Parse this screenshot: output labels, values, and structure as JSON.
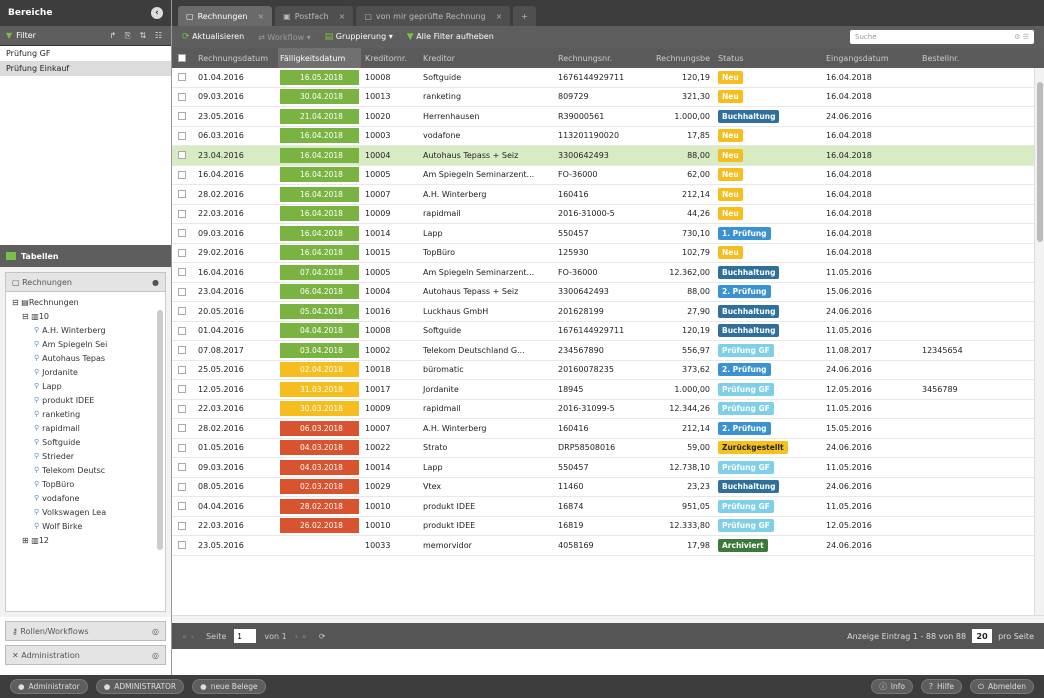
{
  "left": {
    "title": "Bereiche",
    "filter_label": "Filter",
    "filters": [
      "Prüfung GF",
      "Prüfung Einkauf"
    ],
    "tables_label": "Tabellen",
    "tree_header": "Rechnungen",
    "tree": {
      "root": "Rechnungen",
      "group": "10",
      "items": [
        "A.H. Winterberg",
        "Am Spiegeln Sei",
        "Autohaus Tepas",
        "Jordanite",
        "Lapp",
        "produkt IDEE",
        "ranketing",
        "rapidmail",
        "Softguide",
        "Strieder",
        "Telekom Deutsc",
        "TopBüro",
        "vodafone",
        "Volkswagen Lea",
        "Wolf Birke"
      ],
      "group2": "12"
    },
    "rollen": "Rollen/Workflows",
    "admin": "Administration"
  },
  "tabs": [
    {
      "label": "Rechnungen",
      "active": true
    },
    {
      "label": "Postfach",
      "active": false
    },
    {
      "label": "von mir geprüfte Rechnung",
      "active": false
    }
  ],
  "toolbar": {
    "refresh": "Aktualisieren",
    "workflow": "Workflow",
    "grouping": "Gruppierung",
    "clear_filters": "Alle Filter aufheben",
    "search_placeholder": "Suche"
  },
  "columns": [
    "Rechnungsdatum",
    "Fälligkeitsdatum",
    "Kreditornr.",
    "Kreditor",
    "Rechnungsnr.",
    "Rechnungsbe",
    "Status",
    "Eingangsdatum",
    "Bestellnr."
  ],
  "rows": [
    {
      "rd": "01.04.2016",
      "fd": "16.05.2018",
      "due": "green",
      "kn": "10008",
      "kr": "Softguide",
      "rn": "1676144929711",
      "rb": "120,19",
      "st": "Neu",
      "sc": "b-neu",
      "ed": "16.04.2018",
      "bn": ""
    },
    {
      "rd": "09.03.2016",
      "fd": "30.04.2018",
      "due": "green",
      "kn": "10013",
      "kr": "ranketing",
      "rn": "809729",
      "rb": "321,30",
      "st": "Neu",
      "sc": "b-neu",
      "ed": "16.04.2018",
      "bn": ""
    },
    {
      "rd": "23.05.2016",
      "fd": "21.04.2018",
      "due": "green",
      "kn": "10020",
      "kr": "Herrenhausen",
      "rn": "R39000561",
      "rb": "1.000,00",
      "st": "Buchhaltung",
      "sc": "b-buch",
      "ed": "24.06.2016",
      "bn": ""
    },
    {
      "rd": "06.03.2016",
      "fd": "16.04.2018",
      "due": "green",
      "kn": "10003",
      "kr": "vodafone",
      "rn": "113201190020",
      "rb": "17,85",
      "st": "Neu",
      "sc": "b-neu",
      "ed": "16.04.2018",
      "bn": ""
    },
    {
      "rd": "23.04.2016",
      "fd": "16.04.2018",
      "due": "green",
      "kn": "10004",
      "kr": "Autohaus Tepass + Seiz",
      "rn": "3300642493",
      "rb": "88,00",
      "st": "Neu",
      "sc": "b-neu",
      "ed": "16.04.2018",
      "bn": "",
      "sel": true
    },
    {
      "rd": "16.04.2016",
      "fd": "16.04.2018",
      "due": "green",
      "kn": "10005",
      "kr": "Am Spiegeln Seminarzent...",
      "rn": "FO-36000",
      "rb": "62,00",
      "st": "Neu",
      "sc": "b-neu",
      "ed": "16.04.2018",
      "bn": ""
    },
    {
      "rd": "28.02.2016",
      "fd": "16.04.2018",
      "due": "green",
      "kn": "10007",
      "kr": "A.H. Winterberg",
      "rn": "160416",
      "rb": "212,14",
      "st": "Neu",
      "sc": "b-neu",
      "ed": "16.04.2018",
      "bn": ""
    },
    {
      "rd": "22.03.2016",
      "fd": "16.04.2018",
      "due": "green",
      "kn": "10009",
      "kr": "rapidmail",
      "rn": "2016-31000-5",
      "rb": "44,26",
      "st": "Neu",
      "sc": "b-neu",
      "ed": "16.04.2018",
      "bn": ""
    },
    {
      "rd": "09.03.2016",
      "fd": "16.04.2018",
      "due": "green",
      "kn": "10014",
      "kr": "Lapp",
      "rn": "550457",
      "rb": "730,10",
      "st": "1. Prüfung",
      "sc": "b-pr",
      "ed": "16.04.2018",
      "bn": ""
    },
    {
      "rd": "29.02.2016",
      "fd": "16.04.2018",
      "due": "green",
      "kn": "10015",
      "kr": "TopBüro",
      "rn": "125930",
      "rb": "102,79",
      "st": "Neu",
      "sc": "b-neu",
      "ed": "16.04.2018",
      "bn": ""
    },
    {
      "rd": "16.04.2016",
      "fd": "07.04.2018",
      "due": "green",
      "kn": "10005",
      "kr": "Am Spiegeln Seminarzent...",
      "rn": "FO-36000",
      "rb": "12.362,00",
      "st": "Buchhaltung",
      "sc": "b-buch",
      "ed": "11.05.2016",
      "bn": ""
    },
    {
      "rd": "23.04.2016",
      "fd": "06.04.2018",
      "due": "green",
      "kn": "10004",
      "kr": "Autohaus Tepass + Seiz",
      "rn": "3300642493",
      "rb": "88,00",
      "st": "2. Prüfung",
      "sc": "b-pr",
      "ed": "15.06.2016",
      "bn": ""
    },
    {
      "rd": "20.05.2016",
      "fd": "05.04.2018",
      "due": "green",
      "kn": "10016",
      "kr": "Luckhaus GmbH",
      "rn": "201628199",
      "rb": "27,90",
      "st": "Buchhaltung",
      "sc": "b-buch",
      "ed": "24.06.2016",
      "bn": ""
    },
    {
      "rd": "01.04.2016",
      "fd": "04.04.2018",
      "due": "green",
      "kn": "10008",
      "kr": "Softguide",
      "rn": "1676144929711",
      "rb": "120,19",
      "st": "Buchhaltung",
      "sc": "b-buch",
      "ed": "11.05.2016",
      "bn": ""
    },
    {
      "rd": "07.08.2017",
      "fd": "03.04.2018",
      "due": "green",
      "kn": "10002",
      "kr": "Telekom Deutschland G...",
      "rn": "234567890",
      "rb": "556,97",
      "st": "Prüfung GF",
      "sc": "b-gf",
      "ed": "11.08.2017",
      "bn": "12345654"
    },
    {
      "rd": "25.05.2016",
      "fd": "02.04.2018",
      "due": "yellow",
      "kn": "10018",
      "kr": "büromatic",
      "rn": "20160078235",
      "rb": "373,62",
      "st": "2. Prüfung",
      "sc": "b-pr",
      "ed": "24.06.2016",
      "bn": ""
    },
    {
      "rd": "12.05.2016",
      "fd": "31.03.2018",
      "due": "yellow",
      "kn": "10017",
      "kr": "Jordanite",
      "rn": "18945",
      "rb": "1.000,00",
      "st": "Prüfung GF",
      "sc": "b-gf",
      "ed": "12.05.2016",
      "bn": "3456789"
    },
    {
      "rd": "22.03.2016",
      "fd": "30.03.2018",
      "due": "yellow",
      "kn": "10009",
      "kr": "rapidmail",
      "rn": "2016-31099-5",
      "rb": "12.344,26",
      "st": "Prüfung GF",
      "sc": "b-gf",
      "ed": "11.05.2016",
      "bn": ""
    },
    {
      "rd": "28.02.2016",
      "fd": "06.03.2018",
      "due": "red",
      "kn": "10007",
      "kr": "A.H. Winterberg",
      "rn": "160416",
      "rb": "212,14",
      "st": "2. Prüfung",
      "sc": "b-pr",
      "ed": "15.05.2016",
      "bn": ""
    },
    {
      "rd": "01.05.2016",
      "fd": "04.03.2018",
      "due": "red",
      "kn": "10022",
      "kr": "Strato",
      "rn": "DRP58508016",
      "rb": "59,00",
      "st": "Zurückgestellt",
      "sc": "b-zur",
      "ed": "24.06.2016",
      "bn": ""
    },
    {
      "rd": "09.03.2016",
      "fd": "04.03.2018",
      "due": "red",
      "kn": "10014",
      "kr": "Lapp",
      "rn": "550457",
      "rb": "12.738,10",
      "st": "Prüfung GF",
      "sc": "b-gf",
      "ed": "11.05.2016",
      "bn": ""
    },
    {
      "rd": "08.05.2016",
      "fd": "02.03.2018",
      "due": "red",
      "kn": "10029",
      "kr": "Vtex",
      "rn": "11460",
      "rb": "23,23",
      "st": "Buchhaltung",
      "sc": "b-buch",
      "ed": "24.06.2016",
      "bn": ""
    },
    {
      "rd": "04.04.2016",
      "fd": "28.02.2018",
      "due": "red",
      "kn": "10010",
      "kr": "produkt IDEE",
      "rn": "16874",
      "rb": "951,05",
      "st": "Prüfung GF",
      "sc": "b-gf",
      "ed": "11.05.2016",
      "bn": ""
    },
    {
      "rd": "22.03.2016",
      "fd": "26.02.2018",
      "due": "red",
      "kn": "10010",
      "kr": "produkt IDEE",
      "rn": "16819",
      "rb": "12.333,80",
      "st": "Prüfung GF",
      "sc": "b-gf",
      "ed": "12.05.2016",
      "bn": ""
    },
    {
      "rd": "23.05.2016",
      "fd": "",
      "due": "",
      "kn": "10033",
      "kr": "memorvidor",
      "rn": "4058169",
      "rb": "17,98",
      "st": "Archiviert",
      "sc": "b-arch",
      "ed": "24.06.2016",
      "bn": ""
    }
  ],
  "pager": {
    "page_label": "Seite",
    "page": "1",
    "of": "von 1",
    "info": "Anzeige Eintrag 1 - 88 von 88",
    "per_page": "20",
    "per_page_label": "pro Seite"
  },
  "bottom": {
    "user": "Administrator",
    "role": "ADMINISTRATOR",
    "new_docs": "neue Belege",
    "info": "Info",
    "help": "Hilfe",
    "logout": "Abmelden"
  },
  "colors": {
    "green": "#7bb342",
    "yellow": "#f6bd1e",
    "red": "#d8532f",
    "accent": "#7bc043"
  }
}
